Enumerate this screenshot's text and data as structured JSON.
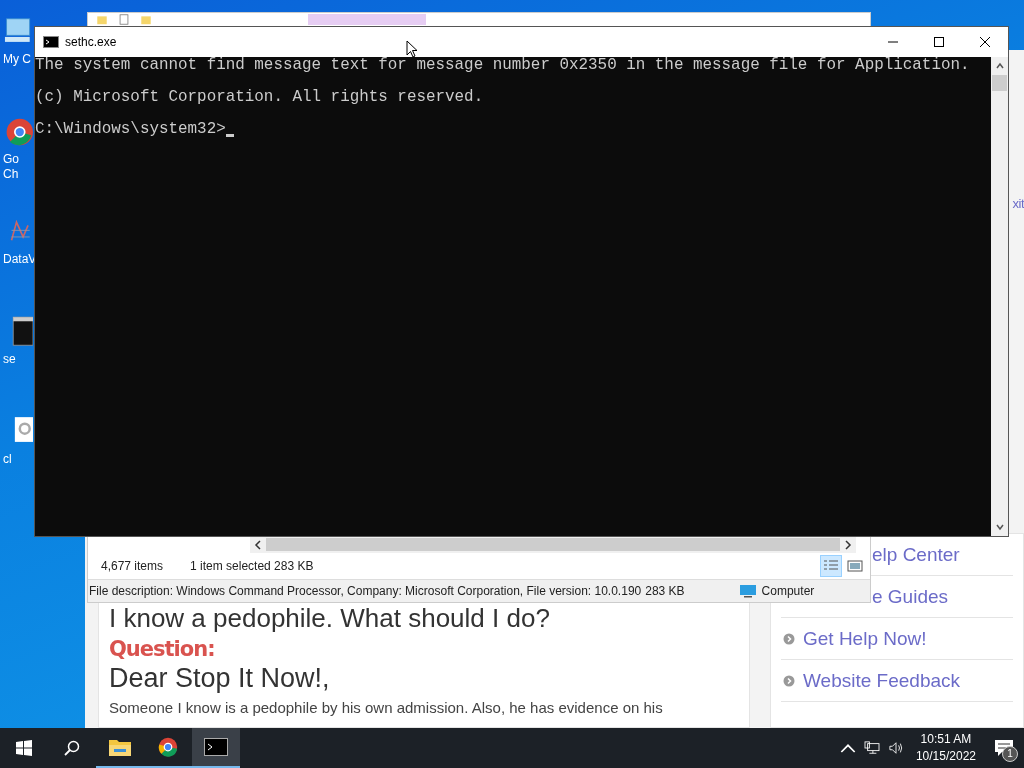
{
  "desktop_icons": [
    {
      "kind": "folder",
      "lines": [
        "My C"
      ]
    },
    {
      "kind": "browser",
      "lines": [
        "Go",
        "Ch"
      ]
    },
    {
      "kind": "chart",
      "lines": [
        "DataV"
      ]
    },
    {
      "kind": "console",
      "lines": [
        "se"
      ]
    },
    {
      "kind": "gear",
      "lines": [
        "cl"
      ]
    }
  ],
  "browser_page": {
    "edge_text": "xit",
    "article": {
      "title": "I know a pedophile. What should I do?",
      "question_label": "Question:",
      "salutation": "Dear Stop It Now!,",
      "body": "Someone I know is a pedophile by his own admission. Also, he has evidence on his"
    },
    "sidebar_links": [
      {
        "kind": "clipped",
        "label": "elp Center"
      },
      {
        "kind": "clipped",
        "label": "e Guides"
      },
      {
        "kind": "full",
        "label": "Get Help Now!"
      },
      {
        "kind": "full",
        "label": "Website Feedback"
      }
    ]
  },
  "explorer": {
    "item_count": "4,677 items",
    "selection": "1 item selected  283 KB",
    "views": [
      {
        "kind": "details",
        "selected": true
      },
      {
        "kind": "preview",
        "selected": false
      }
    ],
    "details": {
      "description": "File description: Windows Command Processor, Company: Microsoft Corporation, File version: 10.0.190",
      "size": "283 KB",
      "location": "Computer"
    }
  },
  "console": {
    "title": "sethc.exe",
    "lines": [
      "The system cannot find message text for message number 0x2350 in the message file for Application.",
      "(c) Microsoft Corporation. All rights reserved."
    ],
    "prompt": "C:\\Windows\\system32>"
  },
  "taskbar": {
    "apps": [
      {
        "kind": "folder",
        "active": false
      },
      {
        "kind": "browser",
        "active": false
      },
      {
        "kind": "console",
        "active": true
      }
    ],
    "time": "10:51 AM",
    "date": "10/15/2022",
    "notification_count": "1"
  }
}
